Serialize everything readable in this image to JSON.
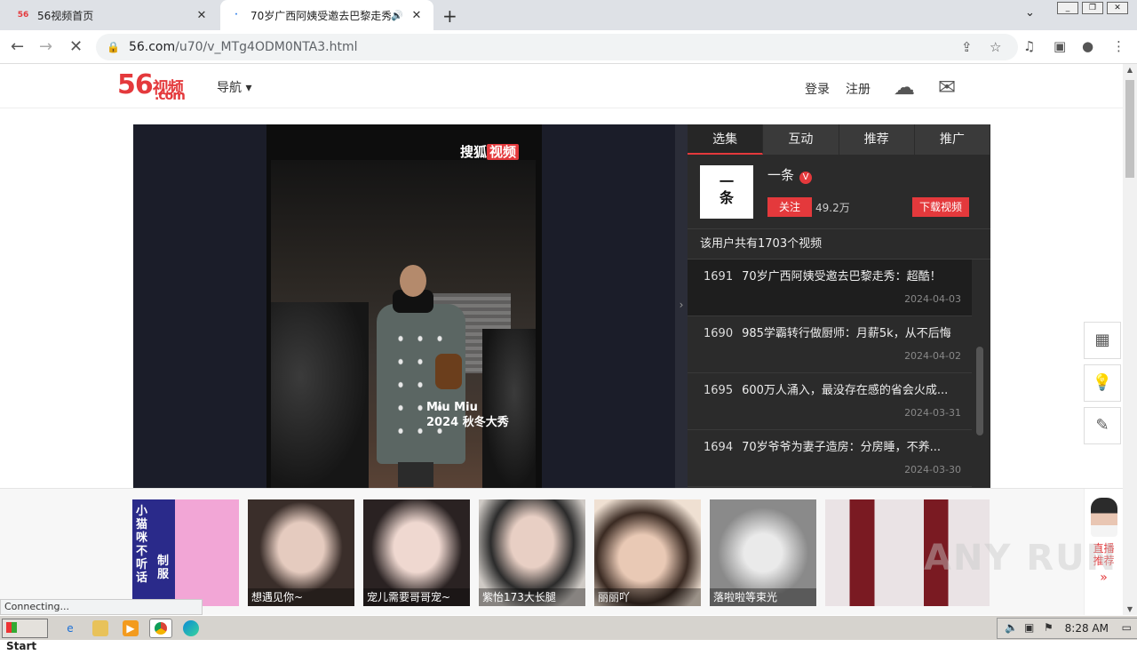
{
  "browser": {
    "tabs": [
      {
        "favicon": "56",
        "title": "56视频首页",
        "close": "✕"
      },
      {
        "favicon": "·",
        "title": "70岁广西阿姨受邀去巴黎走秀",
        "audio": "🔊",
        "close": "✕"
      }
    ],
    "new_tab": "+",
    "tab_search": "⌄",
    "window_buttons": [
      "_",
      "❐",
      "✕"
    ],
    "nav": {
      "back": "←",
      "forward": "→",
      "stop": "✕"
    },
    "url_host": "56.com",
    "url_path": "/u70/v_MTg4ODM0NTA3.html",
    "omni_icons": [
      "share-icon",
      "star-icon"
    ],
    "toolbar_icons": [
      "media-icon",
      "sidepanel-icon",
      "profile-icon",
      "menu-icon"
    ]
  },
  "site": {
    "logo_num": "56",
    "logo_text": "视频",
    "logo_com": ".com",
    "nav_menu": "导航 ▾",
    "login": "登录",
    "register": "注册",
    "upload_icon": "☁",
    "mail_icon": "✉"
  },
  "player": {
    "watermark_a": "搜狐",
    "watermark_b": "视频",
    "caption_line1": "Miu Miu",
    "caption_line2": "2024 秋冬大秀",
    "toggle": "›"
  },
  "panel": {
    "tabs": [
      "选集",
      "互动",
      "推荐",
      "推广"
    ],
    "active_tab": 0,
    "author": {
      "avatar_text": "一\n条",
      "name": "一条",
      "verified": "V",
      "follow_label": "关注",
      "followers": "49.2万",
      "download_label": "下载视频"
    },
    "video_count_text": "该用户共有1703个视频",
    "videos": [
      {
        "num": "1691",
        "title": "70岁广西阿姨受邀去巴黎走秀：超酷！",
        "date": "2024-04-03",
        "active": true
      },
      {
        "num": "1690",
        "title": "985学霸转行做厨师：月薪5k，从不后悔",
        "date": "2024-04-02",
        "active": false
      },
      {
        "num": "1695",
        "title": "600万人涌入，最没存在感的省会火成...",
        "date": "2024-03-31",
        "active": false
      },
      {
        "num": "1694",
        "title": "70岁爷爷为妻子造房：分房睡，不养...",
        "date": "2024-03-30",
        "active": false
      }
    ]
  },
  "float_tools": [
    "qrcode-icon",
    "lightbulb-icon",
    "edit-icon"
  ],
  "ads": [
    {
      "label": "",
      "colors": [
        "#1d1d6b",
        "#c8c8c8"
      ]
    },
    {
      "label": "想遇见你~",
      "colors": [
        "#b9a99a",
        "#3a2e2a"
      ]
    },
    {
      "label": "宠儿需要哥哥宠~",
      "colors": [
        "#d8c8c0",
        "#2a2222"
      ]
    },
    {
      "label": "紫怡173大长腿",
      "colors": [
        "#c8c4c0",
        "#2b2b2b"
      ]
    },
    {
      "label": "丽丽吖",
      "colors": [
        "#e8d8c8",
        "#3a2a22"
      ]
    },
    {
      "label": "落啦啦等束光",
      "colors": [
        "#9a9a9a",
        "#e6e6e6"
      ]
    },
    {
      "label": "",
      "colors": [
        "#e9e1e3",
        "#3a1a1e"
      ]
    }
  ],
  "ad1_text_a": "小猫咪不听话",
  "ad1_text_b": "制服",
  "live": {
    "label1": "直播",
    "label2": "推荐",
    "arrow": "»"
  },
  "status_text": "Connecting...",
  "watermark": "ANY RUN",
  "taskbar": {
    "start": "Start",
    "apps": [
      "ie-icon",
      "folder-icon",
      "media-player-icon",
      "chrome-icon",
      "edge-icon"
    ],
    "clock": "8:28 AM"
  }
}
